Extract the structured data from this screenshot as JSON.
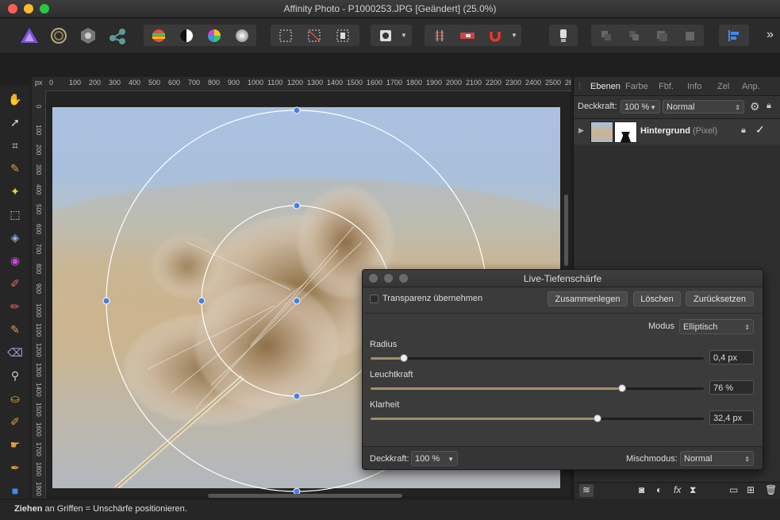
{
  "window": {
    "title": "Affinity Photo - P1000253.JPG [Geändert] (25.0%)"
  },
  "colors": {
    "accent": "#3d8af7",
    "handle": "#4a7fe0",
    "brand_purple": "#7b4fd6"
  },
  "toolbar": {
    "personas": [
      "photo-persona-icon",
      "liquify-persona-icon",
      "develop-persona-icon",
      "export-persona-icon"
    ],
    "overflow": "»"
  },
  "tools": [
    "hand-icon",
    "move-icon",
    "crop-icon",
    "selection-brush-icon",
    "flood-select-icon",
    "marquee-icon",
    "fill-icon",
    "color-picker-icon",
    "paint-brush-icon",
    "dodge-icon",
    "sharpen-icon",
    "clone-icon",
    "zoom-icon",
    "stamp-icon",
    "healing-icon",
    "smudge-icon",
    "pen-icon",
    "vector-brush-icon",
    "shape-icon"
  ],
  "ruler": {
    "unit": "px",
    "h_ticks": [
      "0",
      "100",
      "200",
      "300",
      "400",
      "500",
      "600",
      "700",
      "800",
      "900",
      "1000",
      "1100",
      "1200",
      "1300",
      "1400",
      "1500",
      "1600",
      "1700",
      "1800",
      "1900",
      "2000",
      "2100",
      "2200",
      "2300",
      "2400",
      "2500",
      "260"
    ],
    "v_ticks": [
      "0",
      "100",
      "200",
      "300",
      "400",
      "500",
      "600",
      "700",
      "800",
      "900",
      "1000",
      "1100",
      "1200",
      "1300",
      "1400",
      "1500",
      "1600",
      "1700",
      "1800",
      "1900"
    ]
  },
  "panel": {
    "tabs": [
      "Ebenen",
      "Farbe",
      "Fbf.",
      "Info",
      "Zel",
      "Anp."
    ],
    "opacity_label": "Deckkraft:",
    "opacity_value": "100 %",
    "blend_mode": "Normal",
    "layer": {
      "name": "Hintergrund",
      "type": "(Pixel)"
    }
  },
  "dialog": {
    "title": "Live-Tiefenschärfe",
    "transparency_label": "Transparenz übernehmen",
    "merge_button": "Zusammenlegen",
    "delete_button": "Löschen",
    "reset_button": "Zurücksetzen",
    "mode_label": "Modus",
    "mode_value": "Elliptisch",
    "sliders": [
      {
        "label": "Radius",
        "value": "0,4 px",
        "fraction": 0.1
      },
      {
        "label": "Leuchtkraft",
        "value": "76 %",
        "fraction": 0.755
      },
      {
        "label": "Klarheit",
        "value": "32,4 px",
        "fraction": 0.68
      }
    ],
    "opacity_label": "Deckkraft:",
    "opacity_value": "100 %",
    "blend_label": "Mischmodus:",
    "blend_value": "Normal"
  },
  "status": {
    "bold": "Ziehen",
    "rest": " an Griffen = Unschärfe positionieren."
  }
}
